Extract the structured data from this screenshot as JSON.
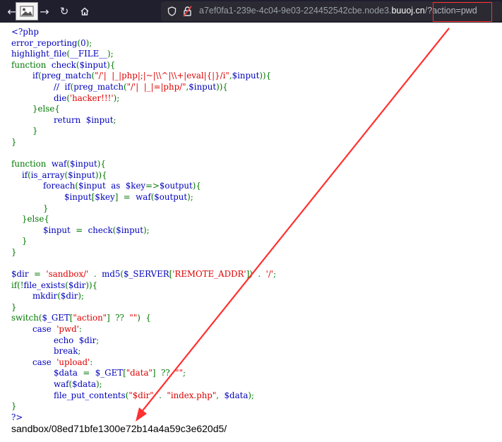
{
  "browser": {
    "url": {
      "host_rest": "a7ef0fa1-239e-4c04-9e03-224452542cbe.node3.",
      "domain": "buuoj.cn",
      "path": "/",
      "query": "?action=pwd"
    }
  },
  "source_code": [
    "<?php",
    "error_reporting(0);",
    "highlight_file(__FILE__);",
    "function  check($input){",
    "        if(preg_match(\"/'|  |_|php|;|~|\\\\^|\\\\+|eval|{|}/i\",$input)){",
    "                //  if(preg_match(\"/'|  |_|=|php/\",$input)){",
    "                die('hacker!!!');",
    "        }else{",
    "                return  $input;",
    "        }",
    "}",
    "",
    "function  waf($input){",
    "    if(is_array($input)){",
    "            foreach($input  as  $key=>$output){",
    "                    $input[$key]  =  waf($output);",
    "            }",
    "    }else{",
    "            $input  =  check($input);",
    "    }",
    "}",
    "",
    "$dir  =  'sandbox/'  .  md5($_SERVER['REMOTE_ADDR'])  .  '/';",
    "if(!file_exists($dir)){",
    "        mkdir($dir);",
    "}",
    "switch($_GET[\"action\"]  ??  \"\")  {",
    "        case  'pwd':",
    "                echo  $dir;",
    "                break;",
    "        case  'upload':",
    "                $data  =  $_GET[\"data\"]  ??  \"\";",
    "                waf($data);",
    "                file_put_contents(\"$dir\"  .  \"index.php\",  $data);",
    "}",
    "?>"
  ],
  "output_text": "sandbox/08ed71bfe1300e72b14a4a59c3e620d5/",
  "icons": {
    "back": "back-arrow-icon",
    "forward": "forward-arrow-icon",
    "reload": "reload-icon",
    "home": "home-icon",
    "shield": "tracking-shield-icon",
    "lock": "insecure-lock-icon",
    "thumbnail": "image-thumbnail-icon"
  },
  "colors": {
    "toolbar": "#1f1f2e",
    "urlbar": "#2b2a33",
    "php_default": "#0000bb",
    "php_keyword": "#007700",
    "php_string": "#dd0000",
    "php_comment": "#ff8000",
    "annotation": "#ff3030"
  }
}
